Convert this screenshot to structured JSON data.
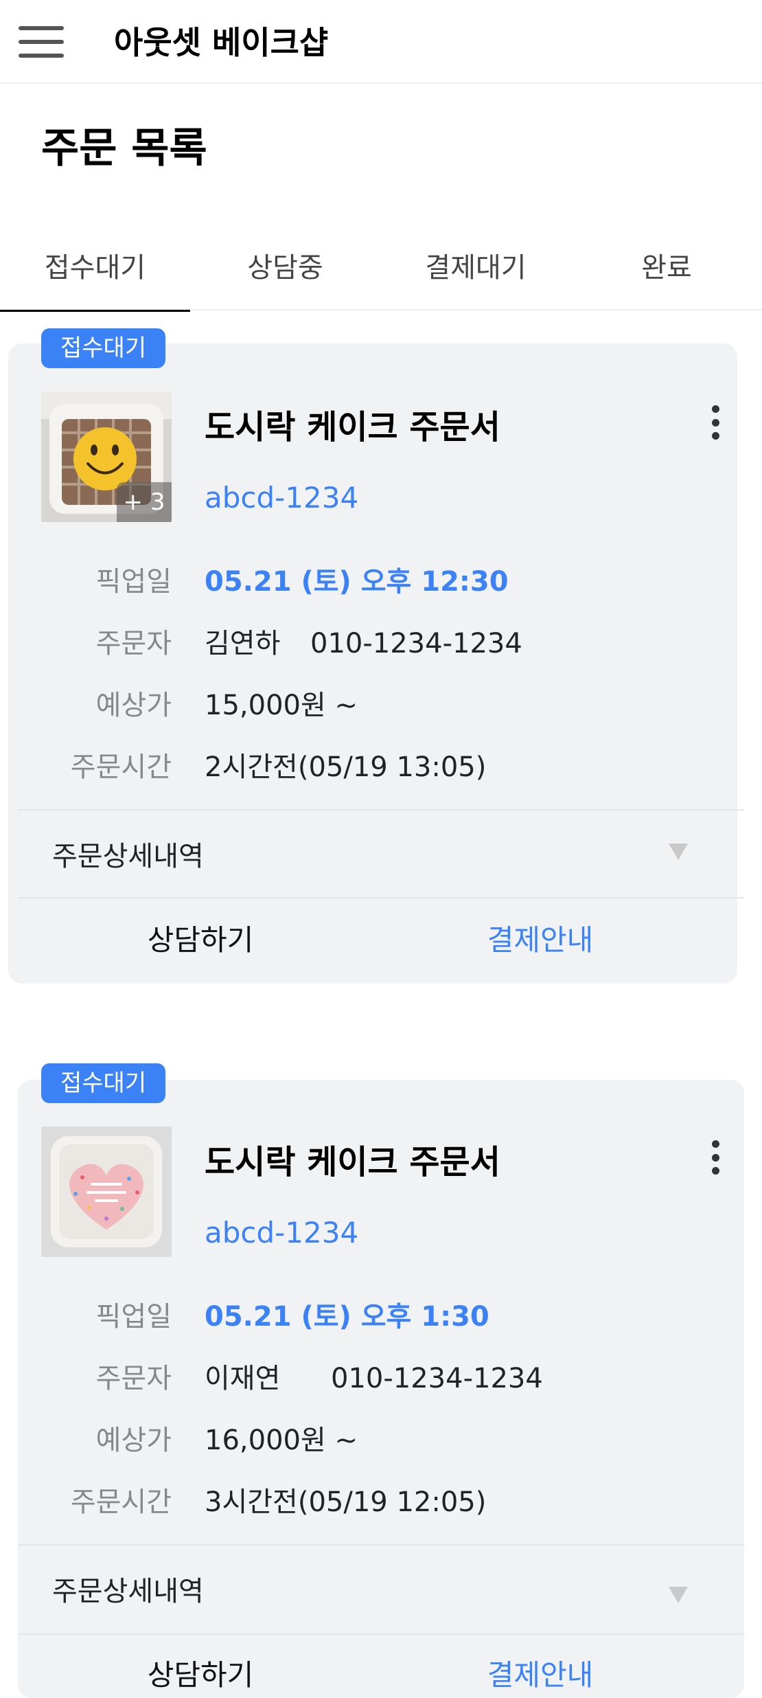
{
  "header": {
    "title": "아웃셋 베이크샵",
    "menu_icon": "hamburger-menu-icon"
  },
  "page": {
    "title": "주문 목록"
  },
  "tabs": [
    {
      "label": "접수대기",
      "active": true
    },
    {
      "label": "상담중",
      "active": false
    },
    {
      "label": "결제대기",
      "active": false
    },
    {
      "label": "완료",
      "active": false
    }
  ],
  "orders": [
    {
      "status_badge": "접수대기",
      "photo_extra_count": "+ 3",
      "title": "도시락 케이크 주문서",
      "order_id": "abcd-1234",
      "pickup_label": "픽업일",
      "pickup_value": "05.21 (토) 오후 12:30",
      "customer_label": "주문자",
      "customer_name": "김연하",
      "customer_phone": "010-1234-1234",
      "price_label": "예상가",
      "price_value": "15,000원 ~",
      "time_label": "주문시간",
      "time_value": "2시간전(05/19 13:05)",
      "details_label": "주문상세내역",
      "consult_label": "상담하기",
      "payment_label": "결제안내"
    },
    {
      "status_badge": "접수대기",
      "title": "도시락 케이크 주문서",
      "order_id": "abcd-1234",
      "pickup_label": "픽업일",
      "pickup_value": "05.21 (토) 오후 1:30",
      "customer_label": "주문자",
      "customer_name": "이재연",
      "customer_phone": "010-1234-1234",
      "price_label": "예상가",
      "price_value": "16,000원 ~",
      "time_label": "주문시간",
      "time_value": "3시간전(05/19 12:05)",
      "details_label": "주문상세내역",
      "consult_label": "상담하기",
      "payment_label": "결제안내"
    }
  ],
  "colors": {
    "accent": "#3b82f6",
    "card_bg": "#f1f2f4"
  }
}
